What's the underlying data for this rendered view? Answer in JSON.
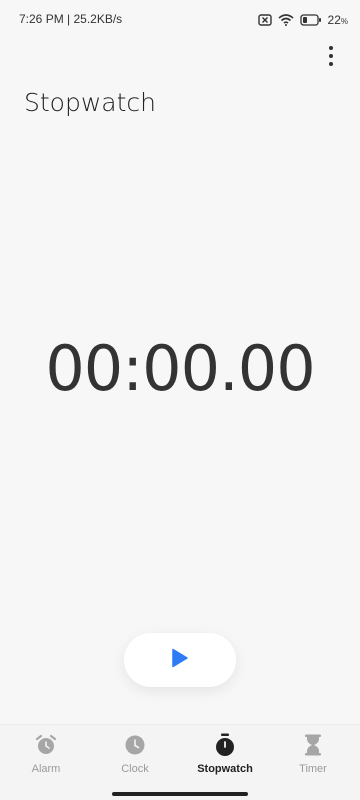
{
  "status_bar": {
    "time_speed": "7:26 PM | 25.2KB/s",
    "battery_percent": "22",
    "battery_unit": "%",
    "icons": [
      "notification-off-icon",
      "wifi-icon",
      "battery-icon"
    ]
  },
  "header": {
    "title": "Stopwatch",
    "menu_icon": "more-vertical-icon"
  },
  "stopwatch": {
    "display": "00:00.00"
  },
  "controls": {
    "start_icon": "play-icon",
    "accent_color": "#2f7bf6"
  },
  "bottom_nav": {
    "items": [
      {
        "label": "Alarm",
        "icon": "alarm-icon",
        "active": false
      },
      {
        "label": "Clock",
        "icon": "clock-icon",
        "active": false
      },
      {
        "label": "Stopwatch",
        "icon": "stopwatch-icon",
        "active": true
      },
      {
        "label": "Timer",
        "icon": "hourglass-icon",
        "active": false
      }
    ]
  }
}
